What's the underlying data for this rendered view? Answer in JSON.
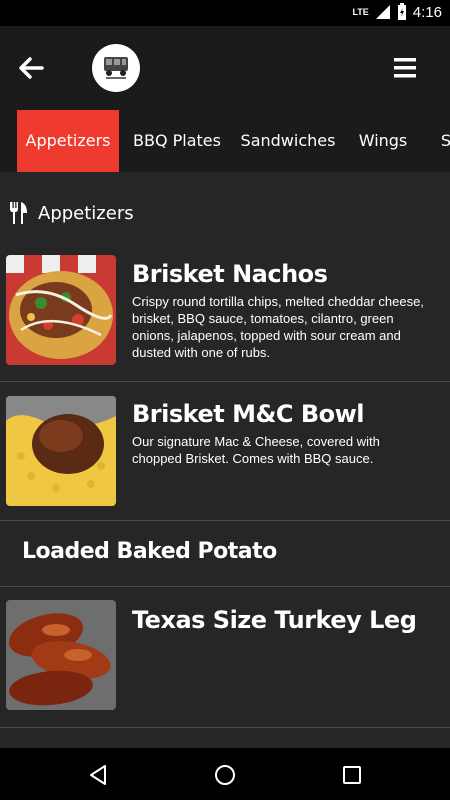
{
  "status_bar": {
    "network": "LTE",
    "time": "4:16"
  },
  "tabs": [
    {
      "label": "Appetizers",
      "active": true
    },
    {
      "label": "BBQ Plates",
      "active": false
    },
    {
      "label": "Sandwiches",
      "active": false
    },
    {
      "label": "Wings",
      "active": false
    },
    {
      "label": "S",
      "active": false
    }
  ],
  "section": {
    "title": "Appetizers",
    "icon": "fork-knife-icon"
  },
  "items": [
    {
      "title": "Brisket Nachos",
      "description": "Crispy round tortilla chips, melted cheddar cheese, brisket, BBQ sauce, tomatoes, cilantro, green onions, jalapenos, topped with sour cream and dusted with one of rubs."
    },
    {
      "title": "Brisket M&C Bowl",
      "description": "Our signature Mac & Cheese, covered with chopped Brisket. Comes with BBQ sauce."
    },
    {
      "title": "Loaded Baked Potato"
    },
    {
      "title": "Texas Size Turkey Leg"
    }
  ],
  "colors": {
    "accent": "#ef3b2f",
    "bar": "#1b1b1b",
    "background": "#262626"
  }
}
